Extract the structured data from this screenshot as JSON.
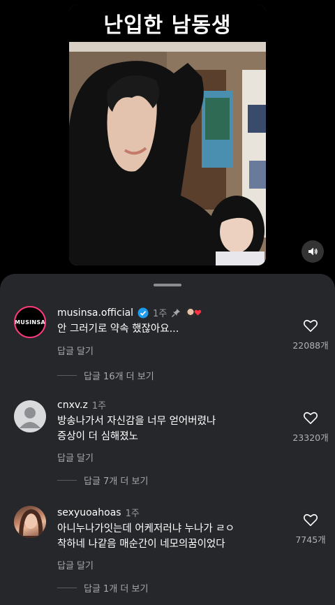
{
  "video": {
    "title": "난입한 남동생",
    "mute_icon": "speaker-icon"
  },
  "sheet": {
    "colors": {
      "background": "#26272b",
      "accent_pink": "#ff3a7a",
      "verified": "#1d9bf0"
    }
  },
  "comments": [
    {
      "avatar_text": "MUSINSA",
      "username": "musinsa.official",
      "verified": true,
      "time": "1주",
      "pinned": true,
      "creator_liked": true,
      "lines": [
        "안 그러기로 약속 했잖아요..."
      ],
      "reply_label": "답글 달기",
      "likes": "22088개",
      "more_replies": "답글 16개 더 보기"
    },
    {
      "username": "cnxv.z",
      "time": "1주",
      "lines": [
        "방송나가서 자신감을 너무 얻어버렸나",
        "증상이 더 심해졌노"
      ],
      "reply_label": "답글 달기",
      "likes": "23320개",
      "more_replies": "답글 7개 더 보기"
    },
    {
      "username": "sexyuoahoas",
      "time": "1주",
      "lines": [
        "아니누나가잇는데 어케저러냐 누나가 ㄹㅇ",
        "착하네 나같음 매순간이 네모의꿈이었다"
      ],
      "reply_label": "답글 달기",
      "likes": "7745개",
      "more_replies": "답글 1개 더 보기"
    }
  ]
}
